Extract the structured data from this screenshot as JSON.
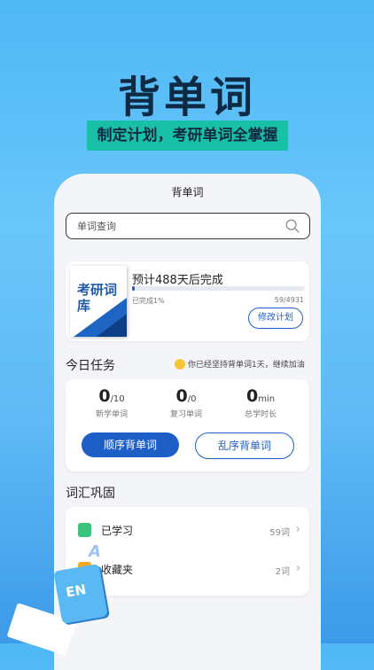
{
  "hero": {
    "title": "背单词",
    "subtitle": "制定计划，考研单词全掌握"
  },
  "header": {
    "title": "背单词"
  },
  "search": {
    "placeholder": "单词查询"
  },
  "plan": {
    "book_title": "考研词库",
    "estimate": "预计488天后完成",
    "done": "已完成1%",
    "progress": "59/4931",
    "progress_percent": 1,
    "edit_label": "修改计划"
  },
  "today": {
    "title": "今日任务",
    "tip": "你已经坚持背单词1天，继续加油",
    "stats": [
      {
        "value": "0",
        "unit": "/10",
        "label": "新学单词"
      },
      {
        "value": "0",
        "unit": "/0",
        "label": "复习单词"
      },
      {
        "value": "0",
        "unit": "min",
        "label": "总学时长"
      }
    ],
    "btn_seq": "顺序背单词",
    "btn_rand": "乱序背单词"
  },
  "vocab": {
    "title": "词汇巩固",
    "items": [
      {
        "label": "已学习",
        "count": "59词",
        "icon": "learned-icon",
        "color": "#3cc47c"
      },
      {
        "label": "收藏夹",
        "count": "2词",
        "icon": "favorite-icon",
        "color": "#f5a623"
      }
    ]
  },
  "deco": {
    "book_label": "EN",
    "letter": "A"
  },
  "colors": {
    "primary": "#1e5fc7",
    "accent": "#17c0a7",
    "title": "#0f2a44"
  }
}
